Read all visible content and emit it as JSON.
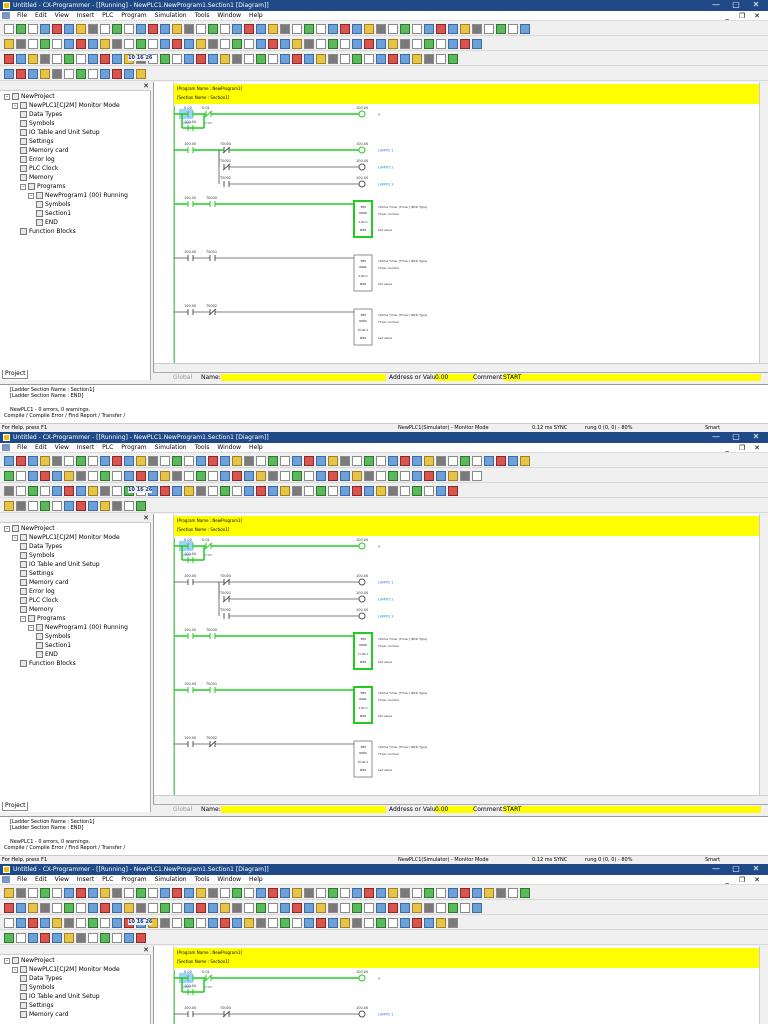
{
  "title": "Untitled - CX-Programmer - [[Running] - NewPLC1.NewProgram1.Section1 [Diagram]]",
  "window_controls": {
    "minimize": "—",
    "maximize": "▢",
    "close": "✕"
  },
  "menu": [
    "File",
    "Edit",
    "View",
    "Insert",
    "PLC",
    "Program",
    "Simulation",
    "Tools",
    "Window",
    "Help"
  ],
  "mdi_controls": {
    "minimize": "_",
    "restore": "❐",
    "close": "✕"
  },
  "toolbar_text": {
    "blocks": "10 16 26"
  },
  "tree": {
    "pane_close": "✕",
    "items": [
      {
        "label": "NewProject"
      },
      {
        "label": "NewPLC1[CJ2M] Monitor Mode"
      },
      {
        "label": "Data Types"
      },
      {
        "label": "Symbols"
      },
      {
        "label": "IO Table and Unit Setup"
      },
      {
        "label": "Settings"
      },
      {
        "label": "Memory card"
      },
      {
        "label": "Error log"
      },
      {
        "label": "PLC Clock"
      },
      {
        "label": "Memory"
      },
      {
        "label": "Programs"
      },
      {
        "label": "NewProgram1 (00) Running"
      },
      {
        "label": "Symbols"
      },
      {
        "label": "Section1"
      },
      {
        "label": "END"
      },
      {
        "label": "Function Blocks"
      }
    ],
    "tab": "Project"
  },
  "ladder": {
    "header_line1": "[Program Name : NewProgram1]",
    "header_line2": "[Section Name : Section1]",
    "rungs": [
      {
        "number": "0",
        "step": "0"
      },
      {
        "number": "1",
        "step": "6"
      },
      {
        "number": "2",
        "step": "16"
      },
      {
        "number": "3",
        "step": "17"
      },
      {
        "number": "4",
        "step": "20"
      }
    ],
    "contacts": {
      "start": "0.00",
      "stop": "0.01",
      "t0000": "T0000",
      "t0001": "T0001",
      "t0002": "T0002",
      "coil": "100.00"
    },
    "coil_labels": {
      "l0": "A",
      "l1": "LAMPU 1",
      "l2": "LAMPU 2",
      "l3": "LAMPU 3"
    },
    "contact_comments": {
      "start": "START",
      "stop": "STOP"
    },
    "timers": [
      {
        "name": "TIM",
        "number": "0000",
        "value": "#50",
        "unit": "0.0bcd"
      },
      {
        "name": "TIM",
        "number": "0001",
        "value": "#50",
        "unit": "0.0bcd"
      },
      {
        "name": "TIM",
        "number": "0002",
        "value": "#50",
        "unit": "20.0bcd"
      }
    ],
    "timers_b": [
      {
        "name": "TIM",
        "number": "0000",
        "value": "#50",
        "unit": "11.0bcd"
      },
      {
        "name": "TIM",
        "number": "0001",
        "value": "#50",
        "unit": "0.0bcd"
      },
      {
        "name": "TIM",
        "number": "0002",
        "value": "#50",
        "unit": "20.0bcd"
      }
    ],
    "timer_desc": "100ms Timer (Timer) [BCD Type]",
    "timer_number": "Timer number",
    "set_value": "Set value"
  },
  "status_row": {
    "global": "Global",
    "name_label": "Name:",
    "address_label": "Address or Value:",
    "address_value": "0.00",
    "comment_label": "Comment:",
    "comment_value": "START"
  },
  "output": {
    "lines": [
      "[Ladder Section Name : Section1]",
      "[Ladder Section Name : END]"
    ],
    "result": "NewPLC1 - 0 errors, 0 warnings.",
    "tabs": "Compile  /  Compile Error  /  Find Report  /  Transfer  /"
  },
  "statusbar": {
    "help": "For Help, press F1",
    "mode": "NewPLC1(Simulator) - Monitor Mode",
    "scan": "0.12 ms  SYNC",
    "rung": "rung 0 (0, 0) - 80%",
    "smart": "Smart"
  }
}
